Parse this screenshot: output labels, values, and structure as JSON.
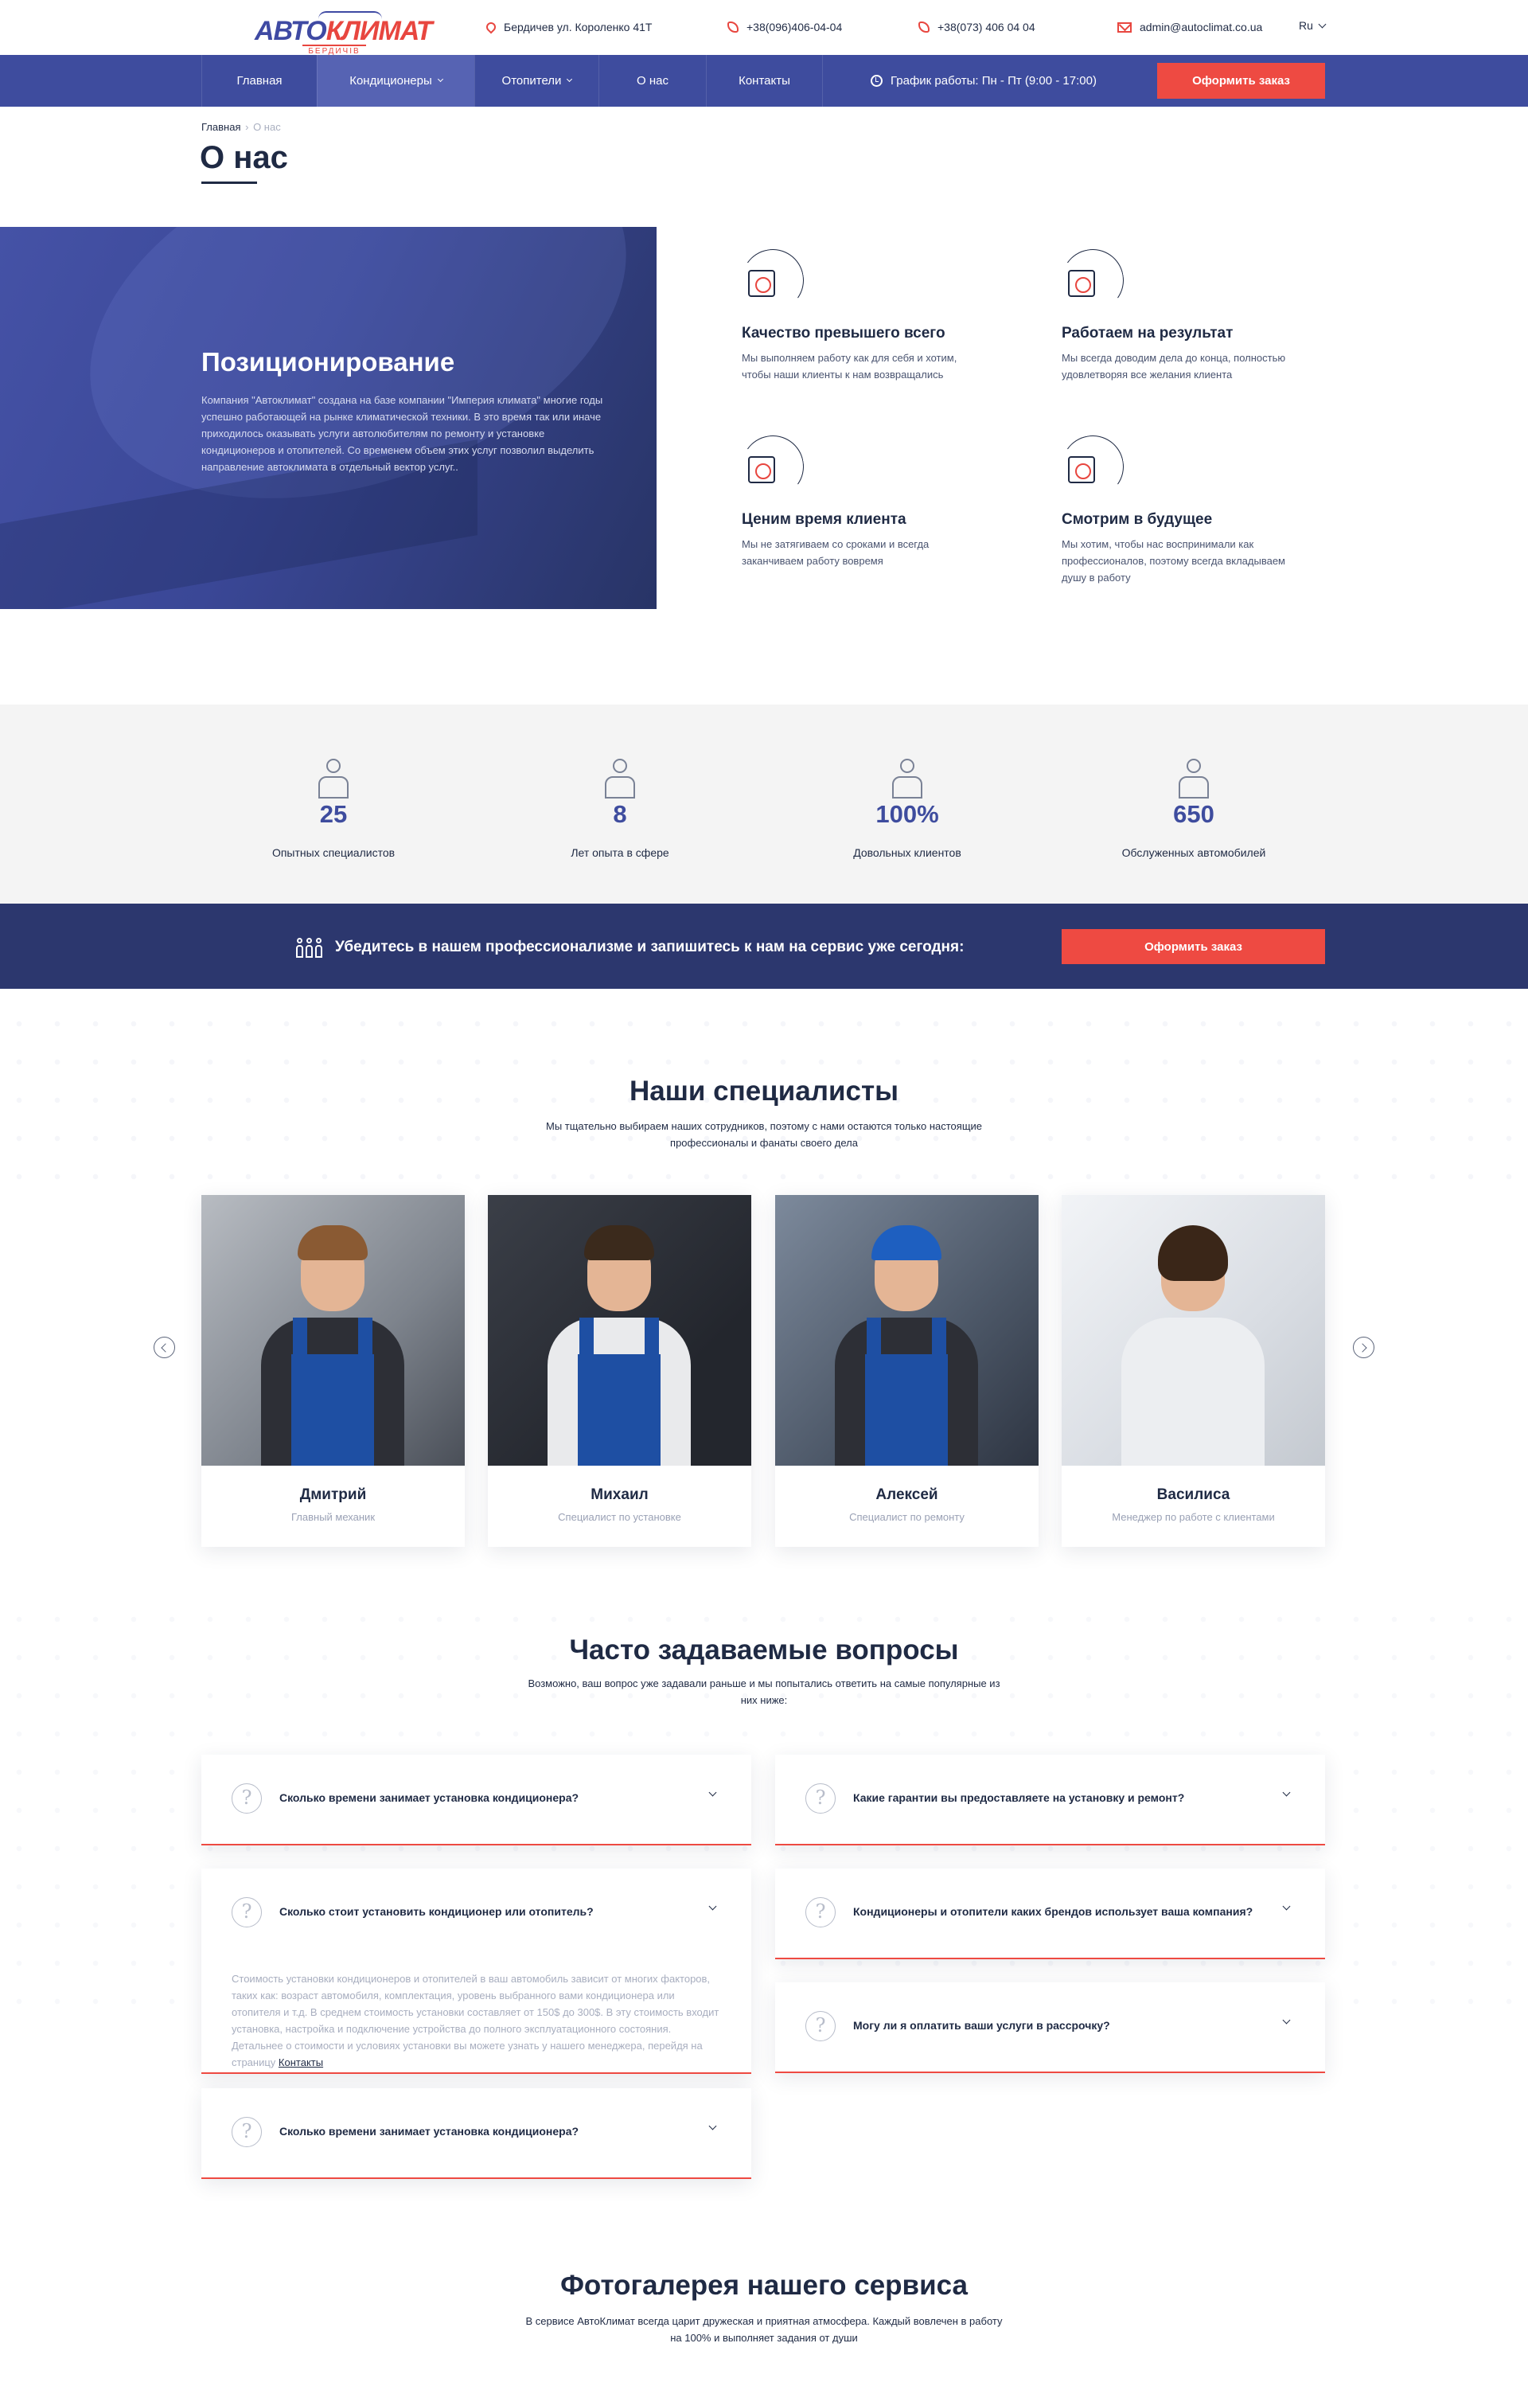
{
  "header": {
    "logo_main_a": "АВТО",
    "logo_main_b": "КЛИМАТ",
    "logo_sub": "БЕРДИЧІВ",
    "address": "Бердичев ул. Короленко 41Т",
    "phone1": "+38(096)406-04-04",
    "phone2": "+38(073) 406 04 04",
    "email": "admin@autoclimat.co.ua",
    "lang": "Ru"
  },
  "nav": {
    "items": [
      {
        "label": "Главная"
      },
      {
        "label": "Кондиционеры"
      },
      {
        "label": "Отопители"
      },
      {
        "label": "О нас"
      },
      {
        "label": "Контакты"
      }
    ],
    "schedule": "График работы:  Пн - Пт (9:00 - 17:00)",
    "order_button": "Оформить заказ"
  },
  "page": {
    "breadcrumb_home": "Главная",
    "breadcrumb_sep": "›",
    "breadcrumb_current": "О нас",
    "title": "О нас"
  },
  "positioning": {
    "title": "Позиционирование",
    "text": "Компания \"Автоклимат\" создана на базе компании \"Империя климата\" многие годы успешно работающей на рынке климатической техники. В это время так или иначе приходилось оказывать услуги автолюбителям по ремонту и установке кондиционеров и отопителей. Со временем объем этих услуг позволил выделить направление автоклимата в отдельный вектор услуг..",
    "features": [
      {
        "title": "Качество превышего всего",
        "text": "Мы выполняем работу как для себя и хотим, чтобы наши клиенты к нам возвращались",
        "icon": "gear-quality-icon"
      },
      {
        "title": "Работаем на результат",
        "text": "Мы всегда доводим дела до конца, полностью удовлетворяя все желания клиента",
        "icon": "chart-search-icon"
      },
      {
        "title": "Ценим время клиента",
        "text": "Мы не затягиваем со сроками и всегда заканчиваем работу вовремя",
        "icon": "calendar-clock-icon"
      },
      {
        "title": "Смотрим в будущее",
        "text": "Мы хотим, чтобы нас воспринимали как профессионалов, поэтому всегда вкладываем душу в работу",
        "icon": "person-future-icon"
      }
    ]
  },
  "stats": [
    {
      "value": "25",
      "label": "Опытных специалистов",
      "icon": "worker-icon"
    },
    {
      "value": "8",
      "label": "Лет опыта в сфере",
      "icon": "flag-steps-icon"
    },
    {
      "value": "100%",
      "label": "Довольных клиентов",
      "icon": "happy-people-icon"
    },
    {
      "value": "650",
      "label": "Обслуженных автомобилей",
      "icon": "car-icon"
    }
  ],
  "cta": {
    "text": "Убедитесь в нашем профессионализме и запишитесь к нам на сервис уже сегодня:",
    "button": "Оформить заказ"
  },
  "specialists": {
    "title": "Наши специалисты",
    "subtitle": "Мы тщательно выбираем наших сотрудников, поэтому с нами остаются только настоящие профессионалы и фанаты своего дела",
    "people": [
      {
        "name": "Дмитрий",
        "role": "Главный механик"
      },
      {
        "name": "Михаил",
        "role": "Специалист по установке"
      },
      {
        "name": "Алексей",
        "role": "Специалист по ремонту"
      },
      {
        "name": "Василиса",
        "role": "Менеджер по работе с клиентами"
      }
    ]
  },
  "faq": {
    "title": "Часто задаваемые вопросы",
    "subtitle": "Возможно, ваш вопрос уже задавали раньше и мы попытались ответить на самые популярные из них ниже:",
    "items": [
      {
        "q": "Сколько времени занимает установка кондиционера?"
      },
      {
        "q": "Сколько стоит установить кондиционер или отопитель?",
        "a": "Стоимость установки кондиционеров и отопителей в ваш автомобиль зависит от многих факторов, таких как: возраст автомобиля, комплектация, уровень выбранного вами кондиционера или отопителя и т.д. В среднем стоимость установки составляет от 150$ до 300$. В эту стоимость входит установка, настройка и подключение устройства до полного эксплуатационного состояния. Детальнее о стоимости и условиях установки вы можете узнать у нашего менеджера, перейдя на страницу ",
        "link": "Контакты"
      },
      {
        "q": "Сколько времени занимает установка кондиционера?"
      },
      {
        "q": "Какие гарантии вы предоставляете на установку и ремонт?"
      },
      {
        "q": "Кондиционеры и отопители каких брендов использует ваша компания?"
      },
      {
        "q": "Могу ли я оплатить ваши услуги в рассрочку?"
      }
    ]
  },
  "gallery": {
    "title": "Фотогалерея нашего сервиса",
    "subtitle": "В сервисе АвтоКлимат всегда царит дружеская и приятная атмосфера. Каждый вовлечен в работу на 100% и выполняет задания от души"
  }
}
